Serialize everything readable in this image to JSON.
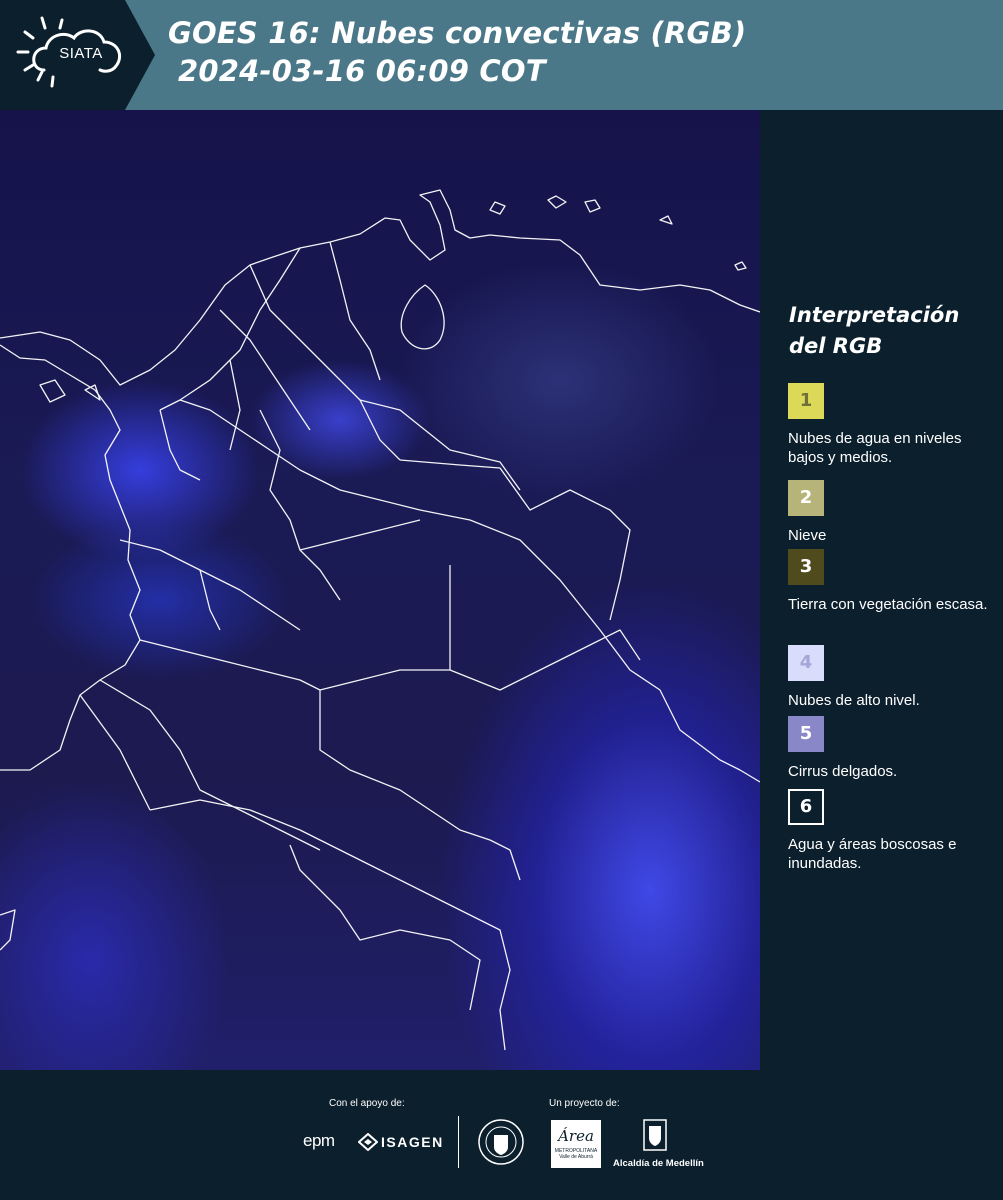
{
  "header": {
    "logo_text": "SIATA",
    "title_line1": "GOES 16: Nubes convectivas (RGB)",
    "title_line2": "2024-03-16 06:09 COT"
  },
  "legend": {
    "title_line1": "Interpretación",
    "title_line2": "del RGB",
    "items": [
      {
        "number": "1",
        "label": "Nubes de agua en niveles bajos y medios.",
        "color": "#dcd858",
        "text_color": "#6f6f3a"
      },
      {
        "number": "2",
        "label": "Nieve",
        "color": "#b7b47a",
        "text_color": "#ffffff"
      },
      {
        "number": "3",
        "label": "Tierra con vegetación escasa.",
        "color": "#4f4b1c",
        "text_color": "#ffffff"
      },
      {
        "number": "4",
        "label": "Nubes de alto nivel.",
        "color": "#d9dcfa",
        "text_color": "#a3a6d6"
      },
      {
        "number": "5",
        "label": "Cirrus delgados.",
        "color": "#8987c7",
        "text_color": "#ffffff"
      },
      {
        "number": "6",
        "label": "Agua y áreas boscosas e inundadas.",
        "color": "#0c1f2c",
        "text_color": "#ffffff"
      }
    ]
  },
  "footer": {
    "support_label": "Con el apoyo de:",
    "project_label": "Un proyecto de:",
    "sponsor_epm": "epm",
    "sponsor_isagen": "ISAGEN",
    "area_logo_text": "Área",
    "area_sub1": "METROPOLITANA",
    "area_sub2": "Valle de Aburrá",
    "alcaldia": "Alcaldía de Medellín"
  },
  "colors": {
    "header_bg": "#4b7888",
    "logo_bg": "#0c1f2c",
    "page_bg": "#0c1f2c"
  }
}
